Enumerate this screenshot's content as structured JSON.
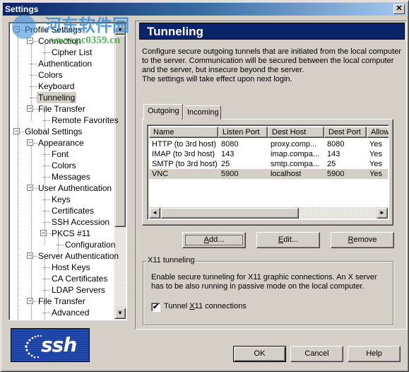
{
  "window": {
    "title": "Settings",
    "close_icon": "close-icon"
  },
  "tree": {
    "items": [
      {
        "label": "Profile Settings",
        "level": 0,
        "expander": "minus"
      },
      {
        "label": "Connection",
        "level": 1,
        "expander": "minus"
      },
      {
        "label": "Cipher List",
        "level": 2
      },
      {
        "label": "Authentication",
        "level": 1
      },
      {
        "label": "Colors",
        "level": 1
      },
      {
        "label": "Keyboard",
        "level": 1
      },
      {
        "label": "Tunneling",
        "level": 1,
        "selected": true
      },
      {
        "label": "File Transfer",
        "level": 1,
        "expander": "minus"
      },
      {
        "label": "Remote Favorites",
        "level": 2
      },
      {
        "label": "Global Settings",
        "level": 0,
        "expander": "minus"
      },
      {
        "label": "Appearance",
        "level": 1,
        "expander": "minus"
      },
      {
        "label": "Font",
        "level": 2
      },
      {
        "label": "Colors",
        "level": 2
      },
      {
        "label": "Messages",
        "level": 2
      },
      {
        "label": "User Authentication",
        "level": 1,
        "expander": "minus"
      },
      {
        "label": "Keys",
        "level": 2
      },
      {
        "label": "Certificates",
        "level": 2
      },
      {
        "label": "SSH Accession",
        "level": 2
      },
      {
        "label": "PKCS #11",
        "level": 2,
        "expander": "minus"
      },
      {
        "label": "Configuration",
        "level": 3
      },
      {
        "label": "Server Authentication",
        "level": 1,
        "expander": "minus"
      },
      {
        "label": "Host Keys",
        "level": 2
      },
      {
        "label": "CA Certificates",
        "level": 2
      },
      {
        "label": "LDAP Servers",
        "level": 2
      },
      {
        "label": "File Transfer",
        "level": 1,
        "expander": "minus"
      },
      {
        "label": "Advanced",
        "level": 2
      }
    ],
    "scroll_up_icon": "▲",
    "scroll_down_icon": "▼"
  },
  "panel": {
    "title": "Tunneling",
    "description": [
      "Configure secure outgoing tunnels that are initiated from the local computer",
      "to the server. Communication will be secured between the local computer",
      "and the server, but insecure beyond the server.",
      "The settings will take effect upon next login."
    ],
    "tabs": [
      {
        "label": "Outgoing",
        "active": true
      },
      {
        "label": "Incoming",
        "active": false
      }
    ],
    "table": {
      "columns": [
        "Name",
        "Listen Port",
        "Dest Host",
        "Dest Port",
        "Allow"
      ],
      "rows": [
        [
          "HTTP (to 3rd host)",
          "8080",
          "proxy.comp...",
          "8080",
          "Yes"
        ],
        [
          "IMAP (to 3rd host)",
          "143",
          "imap.compa...",
          "143",
          "Yes"
        ],
        [
          "SMTP (to 3rd host)",
          "25",
          "smtp.compa...",
          "25",
          "Yes"
        ],
        [
          "VNC",
          "5900",
          "localhost",
          "5900",
          "Yes"
        ]
      ],
      "selected_row": 3,
      "scroll_left_icon": "◄",
      "scroll_right_icon": "►"
    },
    "buttons": {
      "add": {
        "mnemonic": "A",
        "rest": "dd..."
      },
      "edit": {
        "mnemonic": "E",
        "rest": "dit..."
      },
      "remove": {
        "mnemonic": "R",
        "rest": "emove"
      }
    },
    "x11": {
      "group_label": "X11 tunneling",
      "description": [
        "Enable secure tunneling for X11 graphic connections. An X server",
        "has to be also running in passive mode on the local computer."
      ],
      "checkbox_prefix": "Tunnel ",
      "checkbox_mnemonic": "X",
      "checkbox_suffix": "11 connections",
      "checked": true,
      "check_mark": "✔"
    }
  },
  "footer": {
    "logo_text": "ssh",
    "ok": "OK",
    "cancel": "Cancel",
    "help": "Help"
  },
  "watermark": {
    "text": "河东软件园",
    "url": "www.pc0359.cn"
  }
}
